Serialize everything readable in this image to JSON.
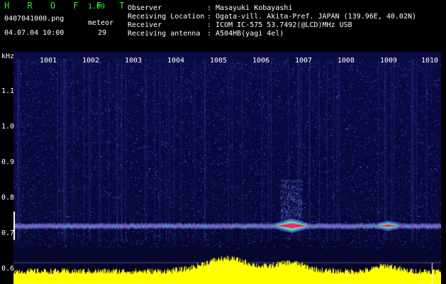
{
  "app": {
    "name": "H R O F F T",
    "version": "1.00",
    "filename": "0407041000.png",
    "datetime": "04.07.04 10:00",
    "meteor_label": "meteor",
    "meteor_count": "29"
  },
  "info": [
    {
      "label": "Observer",
      "value": ": Masayuki Kobayashi"
    },
    {
      "label": "Receiving Location",
      "value": ": Ogata-vill. Akita-Pref. JAPAN (139.96E, 40.02N)"
    },
    {
      "label": "Receiver",
      "value": ": ICOM IC-575 53.7492(@LCD)MHz USB"
    },
    {
      "label": "Receiving antenna",
      "value": ": A504HB(yagi 4el)"
    }
  ],
  "axis": {
    "unit": "kHz",
    "y_ticks": [
      "1.1",
      "1.0",
      "0.9",
      "0.8",
      "0.7",
      "0.6"
    ],
    "x_ticks": [
      "1001",
      "1002",
      "1003",
      "1004",
      "1005",
      "1006",
      "1007",
      "1008",
      "1009",
      "1010"
    ]
  },
  "colors": {
    "header_accent": "#33ee33",
    "bg_plot": "#0a0a40",
    "trace": "#ff2070",
    "activity": "#ffff00"
  }
}
